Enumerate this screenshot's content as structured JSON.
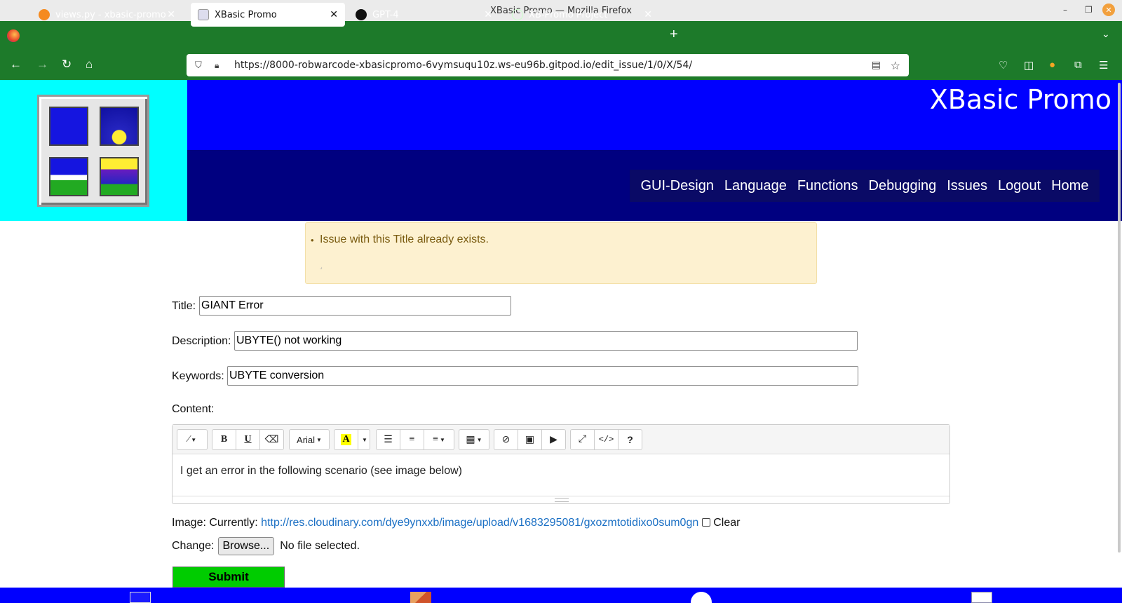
{
  "window": {
    "title": "XBasic Promo — Mozilla Firefox",
    "min": "–",
    "max": "❐",
    "close": "✕"
  },
  "tabs": [
    {
      "label": "views.py - xbasic-promo - Gi",
      "icon": "gitpod-icon"
    },
    {
      "label": "XBasic Promo",
      "icon": "xbasic-icon"
    },
    {
      "label": "GPT-4",
      "icon": "openai-icon"
    },
    {
      "label": "XB-Promo Project",
      "icon": "globe-icon"
    }
  ],
  "tab_close": "✕",
  "new_tab": "+",
  "tab_list": "⌄",
  "nav": {
    "back": "←",
    "forward": "→",
    "reload": "↻",
    "home": "⌂",
    "url": "https://8000-robwarcode-xbasicpromo-6vymsuqu10z.ws-eu96b.gitpod.io/edit_issue/1/0/X/54/"
  },
  "header": {
    "brand": "XBasic Promo",
    "menu": [
      "GUI-Design",
      "Language",
      "Functions",
      "Debugging",
      "Issues",
      "Logout",
      "Home"
    ]
  },
  "alert": {
    "bullet": "•",
    "message": "Issue with this Title already exists."
  },
  "form": {
    "title_label": "Title:",
    "title_value": "GIANT Error",
    "description_label": "Description:",
    "description_value": "UBYTE() not working",
    "keywords_label": "Keywords:",
    "keywords_value": "UBYTE conversion",
    "content_label": "Content:",
    "content_text": "I get an error in the following scenario (see image below)",
    "font_name": "Arial",
    "image_label": "Image: Currently:",
    "image_link": "http://res.cloudinary.com/dye9ynxxb/image/upload/v1683295081/gxozmtotidixo0sum0gn",
    "clear_label": "Clear",
    "change_label": "Change:",
    "browse_label": "Browse...",
    "no_file": "No file selected.",
    "submit_label": "Submit"
  },
  "toolbar_glyphs": {
    "magic": "⁄",
    "bold": "B",
    "underline": "U",
    "eraser": "⌫",
    "highlight": "A",
    "ul": "☰",
    "ol": "≡",
    "align": "≡",
    "table": "▦",
    "link": "⊘",
    "image": "▣",
    "video": "▶",
    "fullscreen": "⤢",
    "code": "</>",
    "help": "?"
  },
  "colors": {
    "tab_bar": "#1d7a2a",
    "logo_bg": "#00ffff",
    "banner_top": "#0000ff",
    "banner_bottom": "#000080",
    "submit": "#00cc00",
    "footer": "#0000ff"
  }
}
